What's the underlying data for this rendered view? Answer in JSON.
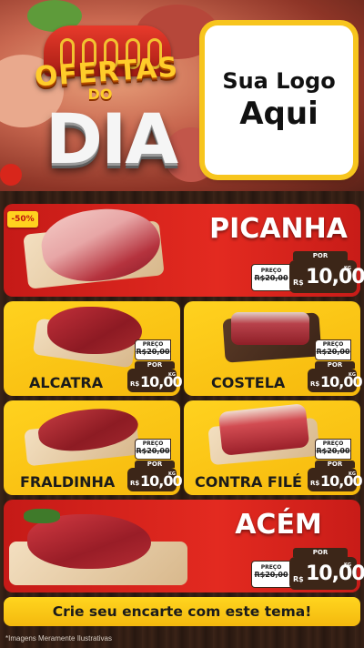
{
  "header": {
    "title_top": "OFERTAS",
    "title_mid": "DO",
    "title_main": "DIA",
    "logo_line1": "Sua Logo",
    "logo_line2": "Aqui"
  },
  "products": [
    {
      "name": "PICANHA",
      "badge": "-50%",
      "por_label": "POR",
      "preco_label": "PREÇO",
      "old_price": "R$20,00",
      "currency": "R$",
      "price": "10,00",
      "unit": "KG"
    },
    {
      "name": "ALCATRA",
      "por_label": "POR",
      "preco_label": "PREÇO",
      "old_price": "R$20,00",
      "currency": "R$",
      "price": "10,00",
      "unit": "KG"
    },
    {
      "name": "COSTELA",
      "por_label": "POR",
      "preco_label": "PREÇO",
      "old_price": "R$20,00",
      "currency": "R$",
      "price": "10,00",
      "unit": "KG"
    },
    {
      "name": "FRALDINHA",
      "por_label": "POR",
      "preco_label": "PREÇO",
      "old_price": "R$20,00",
      "currency": "R$",
      "price": "10,00",
      "unit": "KG"
    },
    {
      "name": "CONTRA FILÉ",
      "por_label": "POR",
      "preco_label": "PREÇO",
      "old_price": "R$20,00",
      "currency": "R$",
      "price": "10,00",
      "unit": "KG"
    },
    {
      "name": "ACÉM",
      "por_label": "POR",
      "preco_label": "PREÇO",
      "old_price": "R$20,00",
      "currency": "R$",
      "price": "10,00",
      "unit": "KG"
    }
  ],
  "cta": "Crie seu encarte com este tema!",
  "footnote": "*Imagens Meramente Ilustrativas",
  "colors": {
    "red": "#d8221b",
    "yellow": "#fbc514",
    "wood": "#3a2317",
    "price_bg": "#3c2618"
  }
}
